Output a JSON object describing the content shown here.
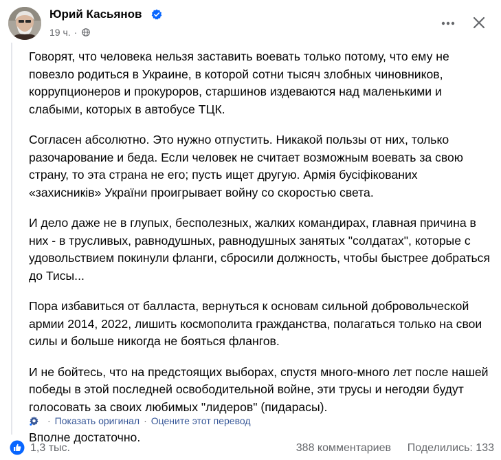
{
  "post": {
    "author": "Юрий Касьянов",
    "time": "19 ч.",
    "separator": "·",
    "paragraphs": [
      "Говорят, что человека нельзя заставить воевать только потому, что ему не повезло родиться в Украине, в которой сотни тысяч злобных чиновников, коррупционеров и прокуроров, старшинов издеваются над маленькими и слабыми, которых в автобусе ТЦК.",
      "Согласен абсолютно. Это нужно отпустить. Никакой пользы от них, только разочарование и беда. Если человек не считает возможным воевать за свою страну, то эта страна не его; пусть ищет другую. Армія бусіфікованих «захисників» України проигрывает войну со скоростью света.",
      "И дело даже не в глупых, бесполезных, жалких командирах, главная причина в них - в трусливых, равнодушных, равнодушных занятых \"солдатах\", которые с удовольствием покинули фланги, сбросили должность, чтобы быстрее добраться до Тисы...",
      "Пора избавиться от балласта, вернуться к основам сильной добровольческой армии 2014, 2022, лишить космополита гражданства, полагаться только на свои силы и больше никогда не бояться флангов.",
      "И не бойтесь, что на предстоящих выборах, спустя много-много лет после нашей победы в этой последней освободительной войне, эти трусы и негодяи будут голосовать за своих любимых \"лидеров\" (пидарасы).",
      "Вполне достаточно."
    ],
    "translation": {
      "show_original": "Показать оригинал",
      "separator": "·",
      "rate": "Оцените этот перевод"
    },
    "footer": {
      "likes": "1,3 тыс.",
      "comments": "388 комментариев",
      "shares": "Поделились: 133"
    }
  },
  "icons": {
    "verified": "verified-badge-icon",
    "globe": "globe-icon",
    "more": "more-options-icon",
    "close": "close-icon",
    "gear": "gear-icon",
    "like": "like-icon"
  },
  "colors": {
    "accent": "#0866ff",
    "link": "#385898",
    "muted": "#65676b"
  }
}
